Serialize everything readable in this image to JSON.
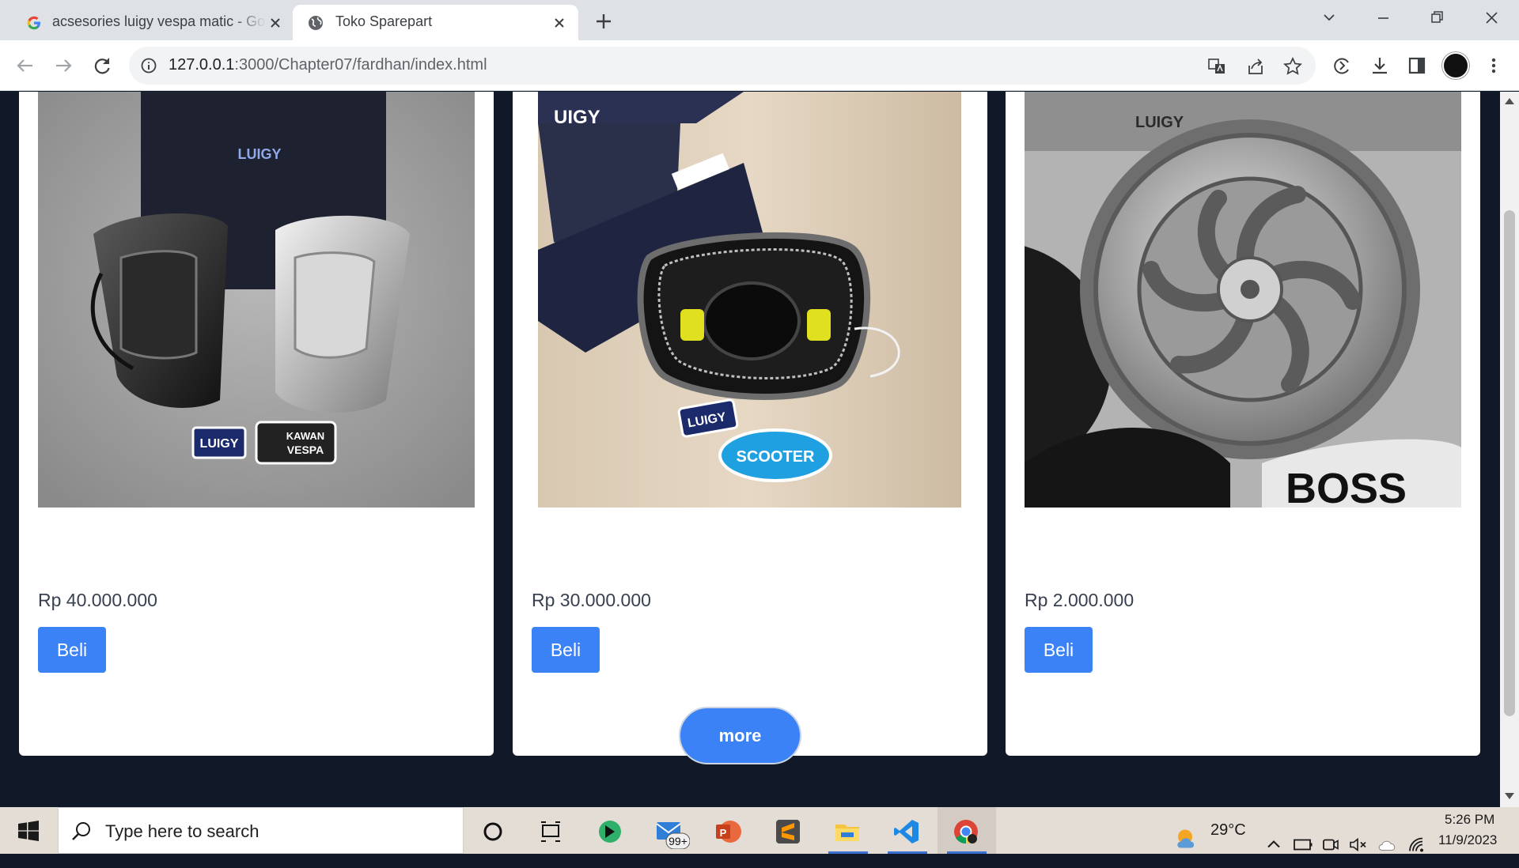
{
  "browser": {
    "tabs": [
      {
        "title": "acsesories luigy vespa matic - Goo",
        "favicon": "google-g-icon"
      },
      {
        "title": "Toko Sparepart",
        "favicon": "globe-icon"
      }
    ],
    "url_host": "127.0.0.1",
    "url_path": ":3000/Chapter07/fardhan/index.html"
  },
  "products": [
    {
      "price": "Rp 40.000.000",
      "button": "Beli",
      "image": "luigy-tail-light-photo"
    },
    {
      "price": "Rp 30.000.000",
      "button": "Beli",
      "image": "luigy-headlight-photo"
    },
    {
      "price": "Rp 2.000.000",
      "button": "Beli",
      "image": "luigy-cvt-cover-photo"
    }
  ],
  "more_button": "more",
  "taskbar": {
    "search_placeholder": "Type here to search",
    "badge": "99+",
    "weather": "29°C",
    "time": "5:26 PM",
    "date": "11/9/2023"
  },
  "colors": {
    "page_bg": "#111827",
    "button_blue": "#3b82f6",
    "card_bg": "#ffffff"
  }
}
